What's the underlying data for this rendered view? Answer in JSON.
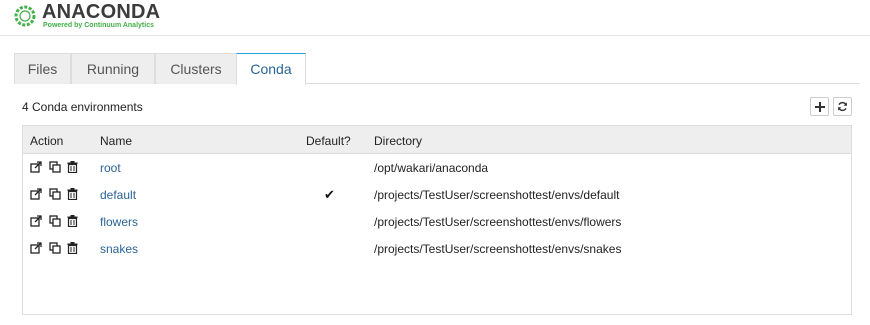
{
  "header": {
    "logo_text": "ANACONDA",
    "logo_subtext": "Powered by Continuum Analytics"
  },
  "tabs": [
    {
      "label": "Files",
      "active": false
    },
    {
      "label": "Running",
      "active": false
    },
    {
      "label": "Clusters",
      "active": false
    },
    {
      "label": "Conda",
      "active": true
    }
  ],
  "toolbar": {
    "env_count": "4 Conda environments",
    "add_icon": "plus-icon",
    "refresh_icon": "refresh-icon"
  },
  "table": {
    "columns": [
      "Action",
      "Name",
      "Default?",
      "Directory"
    ],
    "default_mark": "✔",
    "rows": [
      {
        "name": "root",
        "default": false,
        "directory": "/opt/wakari/anaconda"
      },
      {
        "name": "default",
        "default": true,
        "directory": "/projects/TestUser/screenshottest/envs/default"
      },
      {
        "name": "flowers",
        "default": false,
        "directory": "/projects/TestUser/screenshottest/envs/flowers"
      },
      {
        "name": "snakes",
        "default": false,
        "directory": "/projects/TestUser/screenshottest/envs/snakes"
      }
    ]
  },
  "colors": {
    "link": "#2a6496",
    "brand_green": "#43b049",
    "tab_active_border": "#2a9fd6"
  }
}
